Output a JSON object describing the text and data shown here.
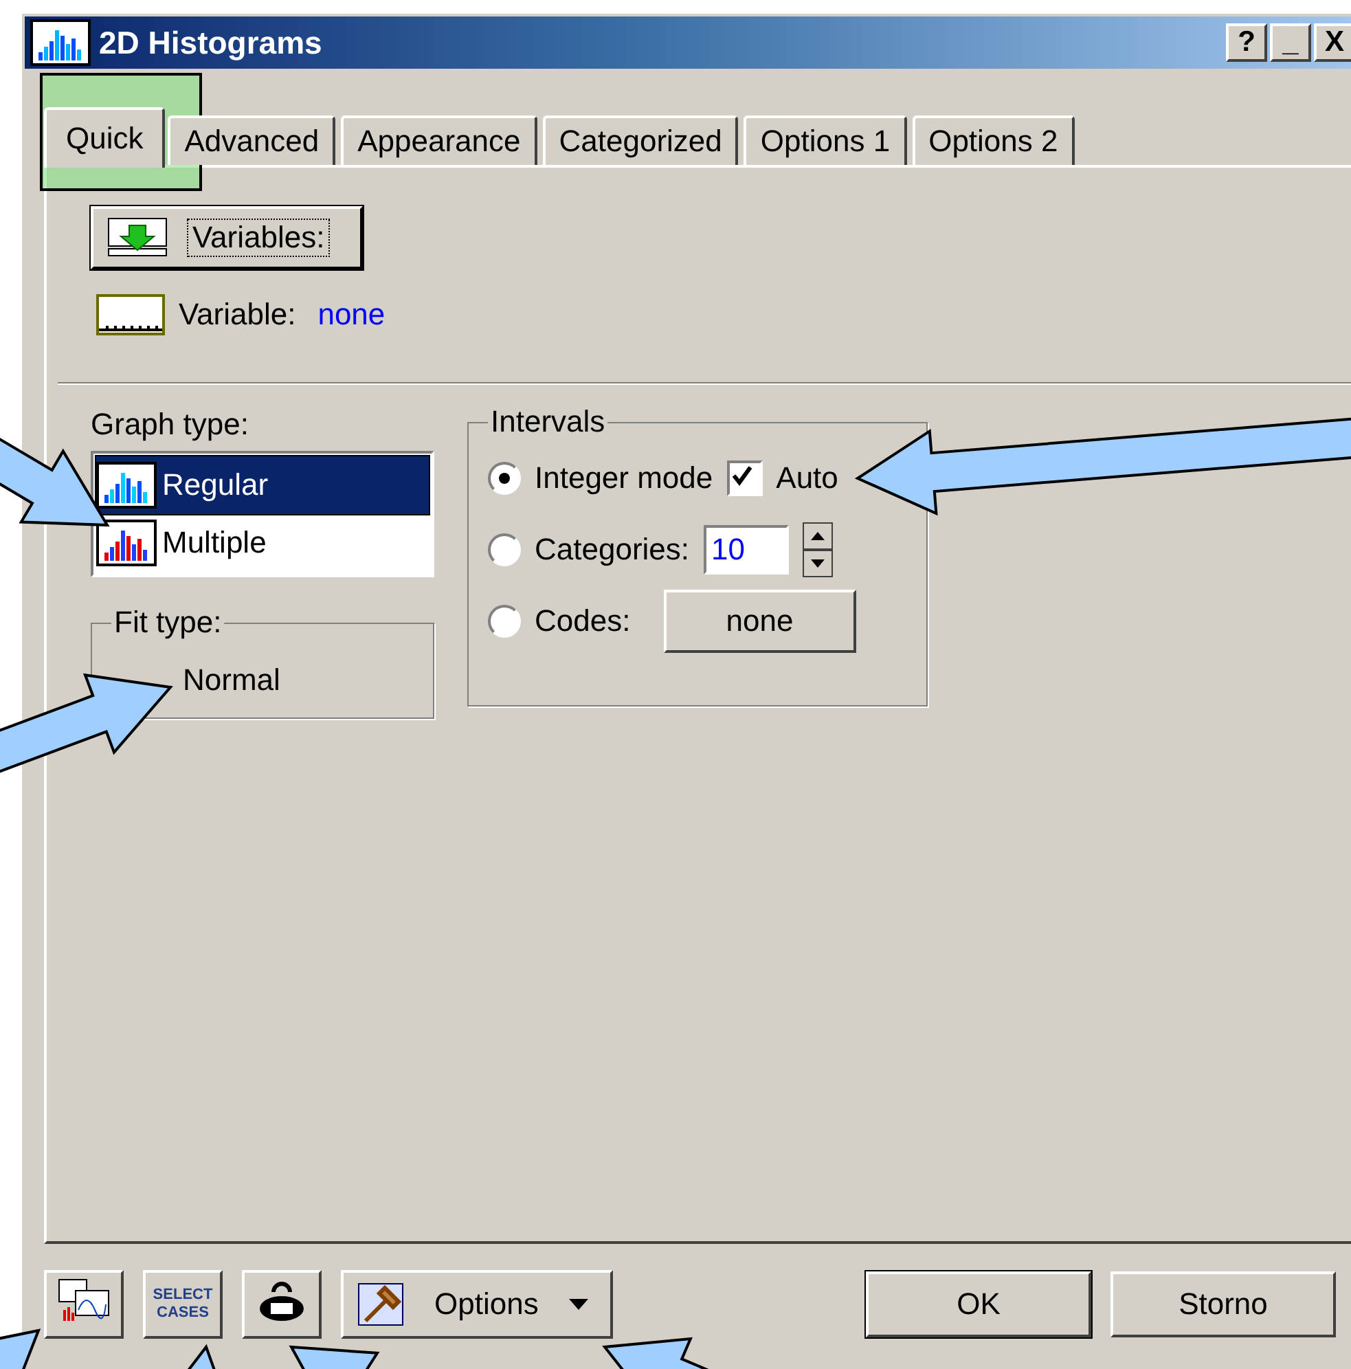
{
  "window": {
    "title": "2D Histograms",
    "controls": [
      "?",
      "_",
      "X"
    ]
  },
  "tabs": [
    {
      "label": "Quick",
      "selected": true
    },
    {
      "label": "Advanced",
      "selected": false
    },
    {
      "label": "Appearance",
      "selected": false
    },
    {
      "label": "Categorized",
      "selected": false
    },
    {
      "label": "Options 1",
      "selected": false
    },
    {
      "label": "Options 2",
      "selected": false
    }
  ],
  "variables_button": {
    "label": "Variables:"
  },
  "variable": {
    "label": "Variable:",
    "value": "none"
  },
  "graph_type": {
    "label": "Graph type:",
    "items": [
      {
        "label": "Regular",
        "kind": "regular",
        "selected": true
      },
      {
        "label": "Multiple",
        "kind": "multiple",
        "selected": false
      }
    ]
  },
  "fit_type": {
    "label": "Fit type:",
    "value": "Normal"
  },
  "intervals": {
    "label": "Intervals",
    "options": [
      {
        "kind": "check",
        "label": "Integer mode",
        "selected": true,
        "checkbox": {
          "label": "Auto",
          "checked": true
        }
      },
      {
        "kind": "spin",
        "label": "Categories:",
        "selected": false,
        "value": "10"
      },
      {
        "kind": "button",
        "label": "Codes:",
        "selected": false,
        "button": "none"
      }
    ]
  },
  "toolbar": {
    "select_cases": [
      "SELECT",
      "CASES"
    ],
    "options_button": "Options"
  },
  "buttons": [
    {
      "label": "OK",
      "default": true
    },
    {
      "label": "Storno",
      "default": false
    }
  ]
}
